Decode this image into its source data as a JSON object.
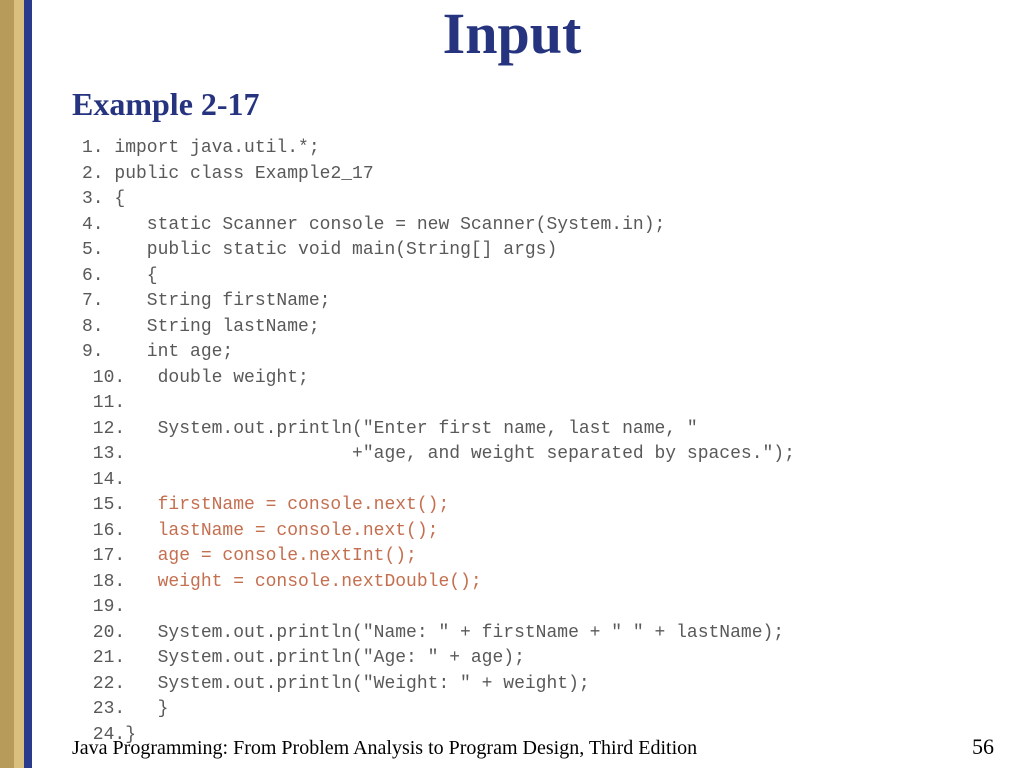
{
  "title": "Input",
  "subtitle": "Example 2-17",
  "code": {
    "l1": "import java.util.*;",
    "l2": "public class Example2_17",
    "l3": "{",
    "l4": "   static Scanner console = new Scanner(System.in);",
    "l5": "   public static void main(String[] args)",
    "l6": "   {",
    "l7": "   String firstName;",
    "l8": "   String lastName;",
    "l9": "   int age;",
    "l10": "   double weight;",
    "l11": "",
    "l12": "   System.out.println(\"Enter first name, last name, \"",
    "l13": "                     +\"age, and weight separated by spaces.\");",
    "l14": "",
    "l15": "   firstName = console.next();",
    "l16": "   lastName = console.next();",
    "l17": "   age = console.nextInt();",
    "l18": "   weight = console.nextDouble();",
    "l19": "",
    "l20": "   System.out.println(\"Name: \" + firstName + \" \" + lastName);",
    "l21": "   System.out.println(\"Age: \" + age);",
    "l22": "   System.out.println(\"Weight: \" + weight);",
    "l23": "   }",
    "l24": "}",
    "n1": "1",
    "n2": "2",
    "n3": "3",
    "n4": "4",
    "n5": "5",
    "n6": "6",
    "n7": "7",
    "n8": "8",
    "n9": "9",
    "n10": "10",
    "n11": "11",
    "n12": "12",
    "n13": "13",
    "n14": "14",
    "n15": "15",
    "n16": "16",
    "n17": "17",
    "n18": "18",
    "n19": "19",
    "n20": "20",
    "n21": "21",
    "n22": "22",
    "n23": "23",
    "n24": "24"
  },
  "footer": {
    "left": "Java Programming: From Problem Analysis to Program Design, Third Edition",
    "right": "56"
  }
}
